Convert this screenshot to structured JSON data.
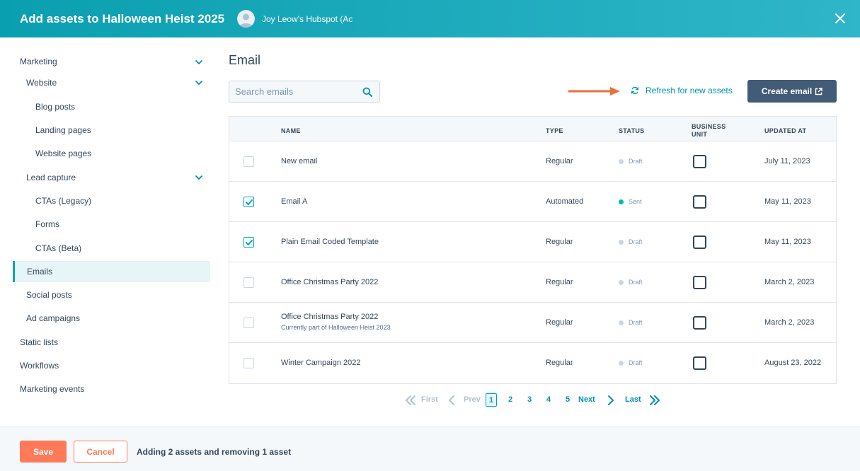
{
  "header": {
    "title": "Add assets to Halloween Heist 2025",
    "account_name": "Joy Leow's Hubspot (Ac"
  },
  "sidebar": {
    "items": [
      {
        "label": "Marketing"
      },
      {
        "label": "Website"
      },
      {
        "label": "Blog posts"
      },
      {
        "label": "Landing pages"
      },
      {
        "label": "Website pages"
      },
      {
        "label": "Lead capture"
      },
      {
        "label": "CTAs (Legacy)"
      },
      {
        "label": "Forms"
      },
      {
        "label": "CTAs (Beta)"
      },
      {
        "label": "Emails"
      },
      {
        "label": "Social posts"
      },
      {
        "label": "Ad campaigns"
      },
      {
        "label": "Static lists"
      },
      {
        "label": "Workflows"
      },
      {
        "label": "Marketing events"
      }
    ],
    "active_item": "Emails"
  },
  "main": {
    "title": "Email",
    "search_placeholder": "Search emails",
    "refresh_label": "Refresh for new assets",
    "create_label": "Create email"
  },
  "table": {
    "columns": {
      "name": "NAME",
      "type": "TYPE",
      "status": "STATUS",
      "business_unit_1": "BUSINESS",
      "business_unit_2": "UNIT",
      "updated_at": "UPDATED AT"
    },
    "rows": [
      {
        "checked": false,
        "name": "New email",
        "sub": "",
        "type": "Regular",
        "status": "Draft",
        "updated": "July 11, 2023"
      },
      {
        "checked": true,
        "name": "Email A",
        "sub": "",
        "type": "Automated",
        "status": "Sent",
        "updated": "May 11, 2023"
      },
      {
        "checked": true,
        "name": "Plain Email Coded Template",
        "sub": "",
        "type": "Regular",
        "status": "Draft",
        "updated": "May 11, 2023"
      },
      {
        "checked": false,
        "name": "Office Christmas Party 2022",
        "sub": "",
        "type": "Regular",
        "status": "Draft",
        "updated": "March 2, 2023"
      },
      {
        "checked": false,
        "name": "Office Christmas Party 2022",
        "sub": "Currently part of Halloween Heist 2023",
        "type": "Regular",
        "status": "Draft",
        "updated": "March 2, 2023"
      },
      {
        "checked": false,
        "name": "Winter Campaign 2022",
        "sub": "",
        "type": "Regular",
        "status": "Draft",
        "updated": "August 23, 2022"
      }
    ]
  },
  "pagination": {
    "first": "First",
    "prev": "Prev",
    "pages": [
      "1",
      "2",
      "3",
      "4",
      "5"
    ],
    "current": "1",
    "next": "Next",
    "last": "Last"
  },
  "footer": {
    "save_label": "Save",
    "cancel_label": "Cancel",
    "message": "Adding 2 assets and removing 1 asset"
  },
  "colors": {
    "header_start": "#0a9fb0",
    "header_end": "#2fb6c8",
    "accent": "#00a4bd",
    "link": "#0091ae",
    "primary_button": "#425b76",
    "save_button": "#ff7a59",
    "arrow": "#f26b3a",
    "status_draft": "#cbd6e2",
    "status_sent": "#00bda5"
  },
  "icons": {
    "close": "close-icon",
    "search": "search-icon",
    "refresh": "refresh-icon",
    "external": "external-link-icon",
    "chevron": "chevron-down-icon"
  }
}
